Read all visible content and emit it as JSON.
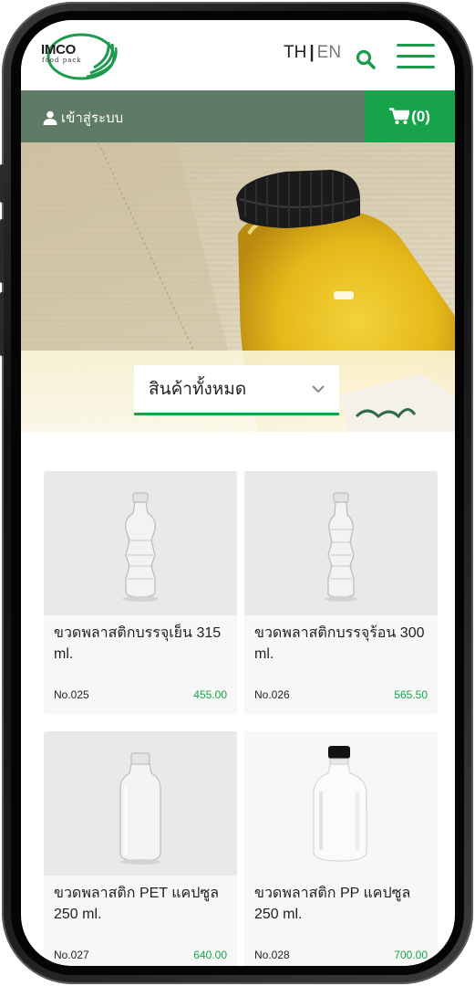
{
  "brand": {
    "name": "IMCO",
    "tagline": "food pack"
  },
  "header": {
    "lang_th": "TH",
    "lang_sep": "|",
    "lang_en": "EN"
  },
  "account": {
    "login_label": "เข้าสู่ระบบ",
    "cart_label": "(0)"
  },
  "filter": {
    "selected": "สินค้าทั้งหมด"
  },
  "products": [
    {
      "name": "ขวดพลาสติกบรรจุเย็น 315 ml.",
      "sku": "No.025",
      "price": "455.00"
    },
    {
      "name": "ขวดพลาสติกบรรจุร้อน 300 ml.",
      "sku": "No.026",
      "price": "565.50"
    },
    {
      "name": "ขวดพลาสติก PET แคปซูล 250 ml.",
      "sku": "No.027",
      "price": "640.00"
    },
    {
      "name": "ขวดพลาสติก PP แคปซูล 250 ml.",
      "sku": "No.028",
      "price": "700.00"
    }
  ],
  "colors": {
    "accent": "#16a34a",
    "bar": "#5f7a66"
  }
}
